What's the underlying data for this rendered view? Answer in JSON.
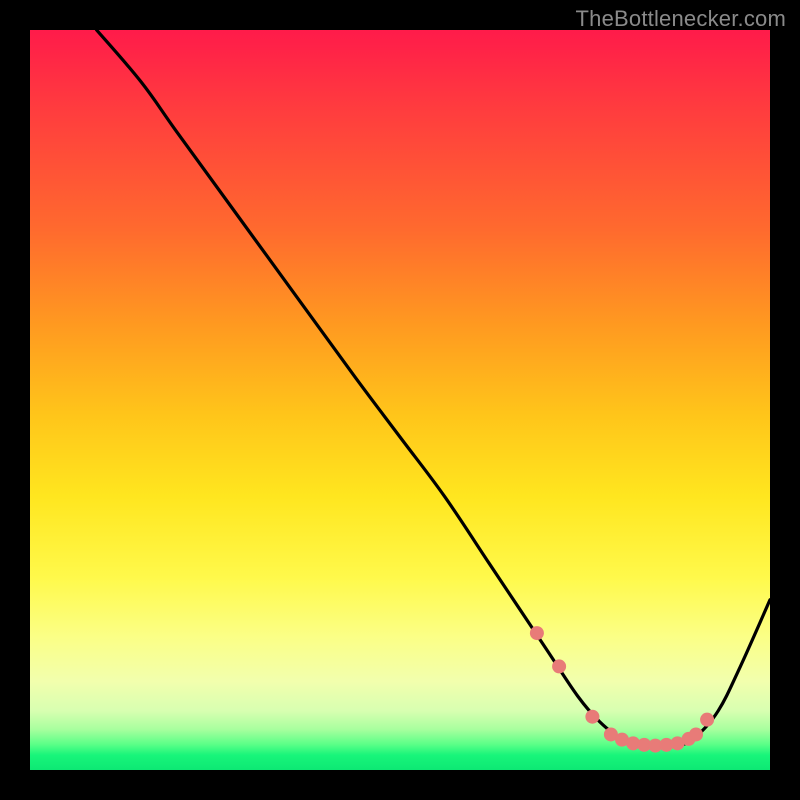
{
  "attribution": "TheBottlenecker.com",
  "chart_data": {
    "type": "line",
    "title": "",
    "xlabel": "",
    "ylabel": "",
    "xlim": [
      0,
      100
    ],
    "ylim": [
      0,
      100
    ],
    "series": [
      {
        "name": "bottleneck-curve",
        "x": [
          9,
          15,
          20,
          28,
          36,
          44,
          50,
          56,
          62,
          66,
          70,
          74,
          77,
          80,
          83,
          85,
          88,
          90,
          93,
          96,
          100
        ],
        "y": [
          100,
          93,
          86,
          75,
          64,
          53,
          45,
          37,
          28,
          22,
          16,
          10,
          6.5,
          4.2,
          3.4,
          3.2,
          3.4,
          4.5,
          8,
          14,
          23
        ]
      }
    ],
    "markers": {
      "name": "highlight-dots",
      "x": [
        68.5,
        71.5,
        76,
        78.5,
        80,
        81.5,
        83,
        84.5,
        86,
        87.5,
        89,
        90,
        91.5
      ],
      "y": [
        18.5,
        14,
        7.2,
        4.8,
        4.1,
        3.6,
        3.4,
        3.3,
        3.4,
        3.6,
        4.2,
        4.8,
        6.8
      ]
    },
    "palette": {
      "curve_stroke": "#000000",
      "marker_fill": "#e87b78",
      "background_black": "#000000"
    }
  }
}
